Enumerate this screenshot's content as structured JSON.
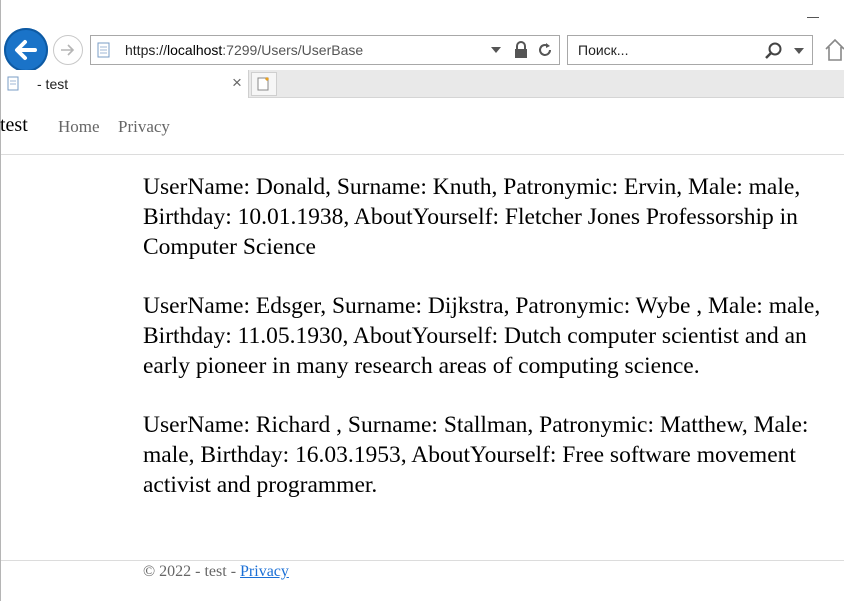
{
  "browser": {
    "url_scheme": "https://",
    "url_host": "localhost",
    "url_rest": ":7299/Users/UserBase",
    "search_placeholder": "Поиск...",
    "tab_title": "- test"
  },
  "site": {
    "brand": "test",
    "nav": {
      "home": "Home",
      "privacy": "Privacy"
    }
  },
  "users": [
    "UserName: Donald, Surname: Knuth, Patronymic: Ervin, Male: male, Birthday: 10.01.1938, AboutYourself: Fletcher Jones Professorship in Computer Science",
    "UserName: Edsger, Surname: Dijkstra, Patronymic: Wybe , Male: male, Birthday: 11.05.1930, AboutYourself: Dutch computer scientist and an early pioneer in many research areas of computing science.",
    "UserName: Richard , Surname: Stallman, Patronymic: Matthew, Male: male, Birthday: 16.03.1953, AboutYourself: Free software movement activist and programmer."
  ],
  "footer": {
    "text": "© 2022 - test - ",
    "privacy_link": "Privacy"
  },
  "colors": {
    "accent": "#1a73c8",
    "link": "#1a6fd6"
  }
}
